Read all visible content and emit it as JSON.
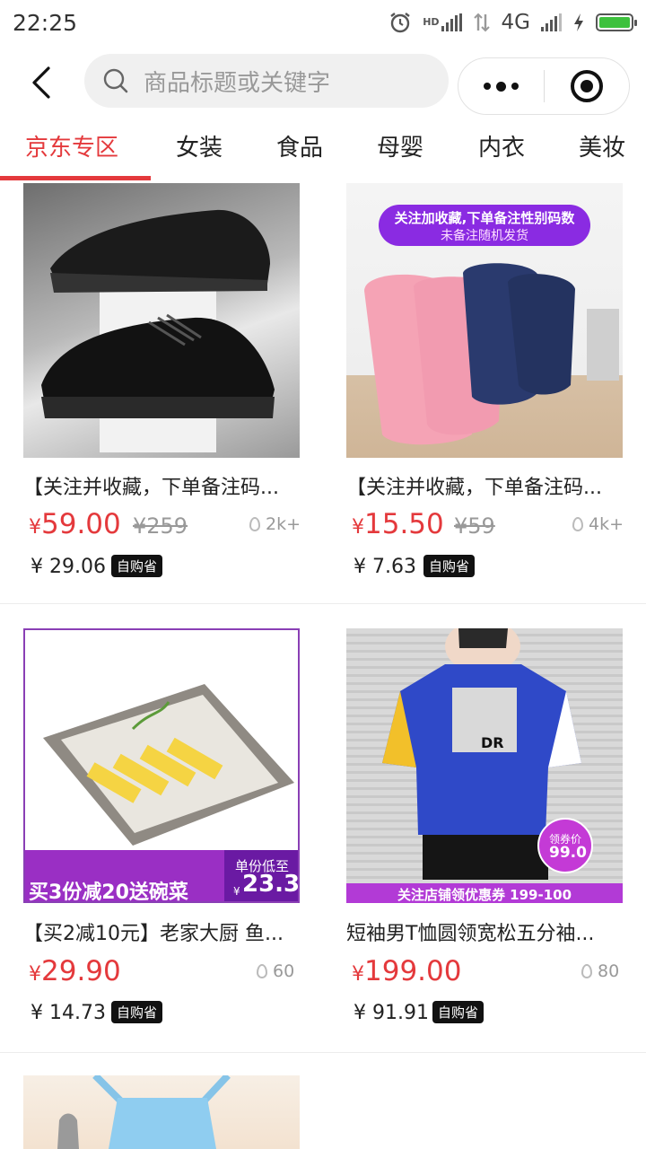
{
  "status": {
    "time": "22:25",
    "network": "4G",
    "hd": "HD"
  },
  "search": {
    "placeholder": "商品标题或关键字"
  },
  "tabs": [
    "京东专区",
    "女装",
    "食品",
    "母婴",
    "内衣",
    "美妆"
  ],
  "colors": {
    "accent": "#e4393c",
    "badge_bg": "#111111"
  },
  "products": [
    {
      "title": "【关注并收藏，下单备注码...",
      "currency": "¥",
      "price": "59.00",
      "original": "¥259",
      "sold": "2k+",
      "save": "¥ 29.06",
      "badge": "自购省",
      "image": "black-leather-shoes"
    },
    {
      "title": "【关注并收藏，下单备注码...",
      "currency": "¥",
      "price": "15.50",
      "original": "¥59",
      "sold": "4k+",
      "save": "¥ 7.63",
      "badge": "自购省",
      "image": "pink-navy-slippers",
      "banner_line1": "关注加收藏,下单备注性别码数",
      "banner_line2": "未备注随机发货"
    },
    {
      "title": "【买2减10元】老家大厨 鱼...",
      "currency": "¥",
      "price": "29.90",
      "original": "",
      "sold": "60",
      "save": "¥ 14.73",
      "badge": "自购省",
      "image": "fish-tofu-plate",
      "promo": "买3份减20送碗菜",
      "promo_tag": "单份低至",
      "promo_price": "23.3",
      "promo_currency": "¥"
    },
    {
      "title": "短袖男T恤圆领宽松五分袖...",
      "currency": "¥",
      "price": "199.00",
      "original": "",
      "sold": "80",
      "save": "¥ 91.91",
      "badge": "自购省",
      "image": "blue-tshirt-model",
      "coupon_label": "领券价",
      "coupon_price": "99.0",
      "strip": "关注店铺领优惠券 199-100",
      "print": "DR"
    },
    {
      "title": "",
      "image": "apron"
    }
  ]
}
